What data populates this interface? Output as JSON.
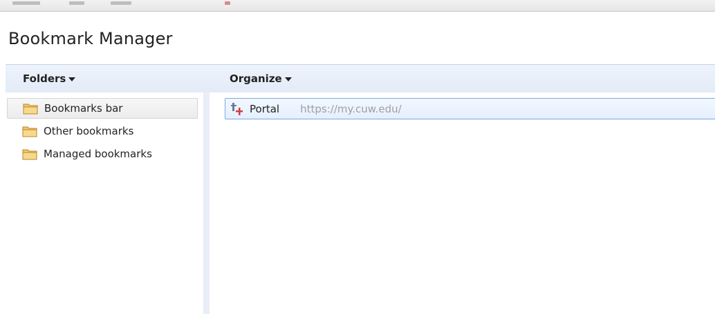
{
  "page": {
    "title": "Bookmark Manager"
  },
  "toolbar": {
    "folders_label": "Folders",
    "organize_label": "Organize"
  },
  "folders": [
    {
      "label": "Bookmarks bar",
      "icon": "folder-icon",
      "selected": true
    },
    {
      "label": "Other bookmarks",
      "icon": "folder-icon",
      "selected": false
    },
    {
      "label": "Managed bookmarks",
      "icon": "folder-icon",
      "selected": false
    }
  ],
  "bookmarks": [
    {
      "title": "Portal",
      "url": "https://my.cuw.edu/",
      "icon": "portal-favicon-icon",
      "selected": true
    }
  ],
  "colors": {
    "header_bar": "#e3ebf8",
    "selection_border": "#7aa7e6",
    "url_text": "#a0a0a0",
    "folder_fill": "#f2c76b"
  }
}
